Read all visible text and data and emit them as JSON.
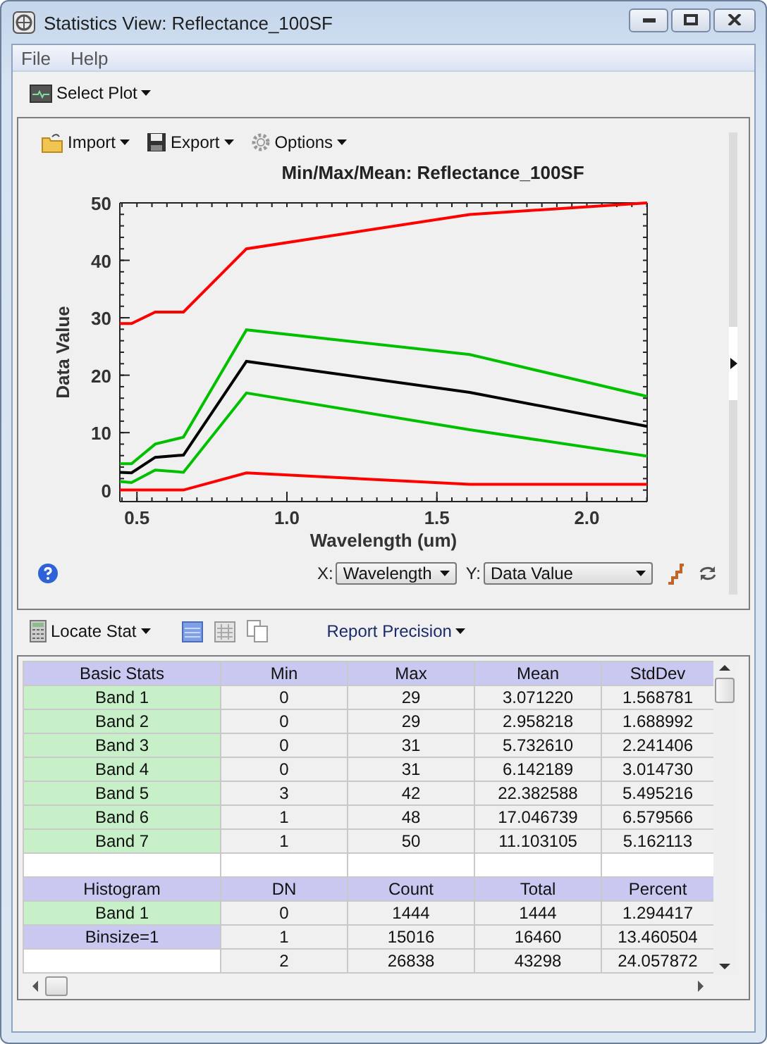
{
  "window": {
    "title": "Statistics View: Reflectance_100SF"
  },
  "menu": [
    "File",
    "Help"
  ],
  "toolbar": {
    "select_plot": "Select Plot"
  },
  "plot": {
    "toolbar": [
      "Import",
      "Export",
      "Options"
    ],
    "chart_data": {
      "type": "line",
      "title": "Min/Max/Mean: Reflectance_100SF",
      "xlabel": "Wavelength (um)",
      "ylabel": "Data Value",
      "x": [
        0.443,
        0.482,
        0.561,
        0.655,
        0.865,
        1.609,
        2.201
      ],
      "series": [
        {
          "color": "#ff0000",
          "values": [
            0,
            0,
            0,
            0,
            3,
            1,
            1
          ]
        },
        {
          "color": "#ff0000",
          "values": [
            29,
            29,
            31,
            31,
            42,
            48,
            50
          ]
        },
        {
          "color": "#00c000",
          "values": [
            4.6,
            4.6,
            8,
            9.2,
            27.9,
            23.6,
            16.3
          ]
        },
        {
          "color": "#00c000",
          "values": [
            1.5,
            1.3,
            3.5,
            3.1,
            16.9,
            10.5,
            5.9
          ]
        },
        {
          "color": "#000000",
          "values": [
            3.1,
            3,
            5.7,
            6.1,
            22.4,
            17,
            11.1
          ]
        }
      ],
      "xlim": [
        0.443,
        2.201
      ],
      "ylim": [
        -2,
        50
      ],
      "xticks": [
        {
          "value": 0.5,
          "label": "0.5"
        },
        {
          "value": 1,
          "label": "1.0"
        },
        {
          "value": 1.5,
          "label": "1.5"
        },
        {
          "value": 2,
          "label": "2.0"
        }
      ],
      "yticks": [
        0,
        10,
        20,
        30,
        40,
        50
      ]
    },
    "x_axis": {
      "label": "X:",
      "value": "Wavelength"
    },
    "y_axis": {
      "label": "Y:",
      "value": "Data Value"
    }
  },
  "stats_toolbar": {
    "locate": "Locate Stat",
    "precision": "Report Precision"
  },
  "basic_stats": {
    "columns": [
      "Basic Stats",
      "Min",
      "Max",
      "Mean",
      "StdDev"
    ],
    "rows": [
      {
        "kind": "band",
        "cells": [
          "Band 1",
          "0",
          "29",
          "3.071220",
          "1.568781"
        ]
      },
      {
        "kind": "band",
        "cells": [
          "Band 2",
          "0",
          "29",
          "2.958218",
          "1.688992"
        ]
      },
      {
        "kind": "band",
        "cells": [
          "Band 3",
          "0",
          "31",
          "5.732610",
          "2.241406"
        ]
      },
      {
        "kind": "band",
        "cells": [
          "Band 4",
          "0",
          "31",
          "6.142189",
          "3.014730"
        ]
      },
      {
        "kind": "band",
        "cells": [
          "Band 5",
          "3",
          "42",
          "22.382588",
          "5.495216"
        ]
      },
      {
        "kind": "band",
        "cells": [
          "Band 6",
          "1",
          "48",
          "17.046739",
          "6.579566"
        ]
      },
      {
        "kind": "band",
        "cells": [
          "Band 7",
          "1",
          "50",
          "11.103105",
          "5.162113"
        ]
      }
    ]
  },
  "histogram": {
    "columns": [
      "Histogram",
      "DN",
      "Count",
      "Total",
      "Percent"
    ],
    "rows": [
      {
        "kind": "band",
        "cells": [
          "Band 1",
          "0",
          "1444",
          "1444",
          "1.294417"
        ]
      },
      {
        "kind": "binsize",
        "cells": [
          "Binsize=1",
          "1",
          "15016",
          "16460",
          "13.460504"
        ]
      },
      {
        "kind": "plain",
        "cells": [
          "",
          "2",
          "26838",
          "43298",
          "24.057872"
        ]
      }
    ]
  }
}
